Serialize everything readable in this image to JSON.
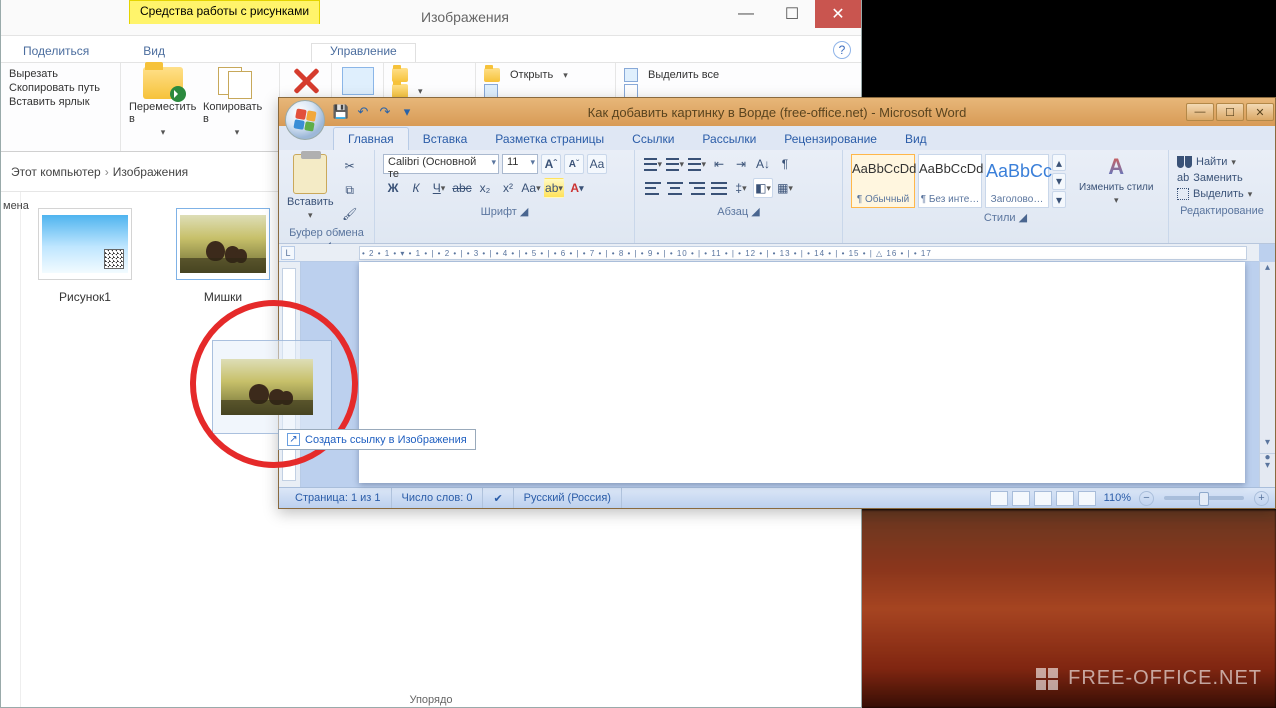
{
  "explorer": {
    "context_tab": "Средства работы с рисунками",
    "title": "Изображения",
    "tabs": {
      "share": "Поделиться",
      "view": "Вид",
      "manage": "Управление"
    },
    "ribbon": {
      "clipboard": {
        "cut": "Вырезать",
        "copy_path": "Скопировать путь",
        "paste_shortcut": "Вставить ярлык"
      },
      "org": {
        "move_to": "Переместить в",
        "copy_to": "Копировать в",
        "organize_label": "Упорядо"
      },
      "open": {
        "open": "Открыть",
        "select_all": "Выделить все"
      }
    },
    "breadcrumb": {
      "root": "Этот компьютер",
      "folder": "Изображения"
    },
    "sidebar_header": "мена",
    "files": {
      "f1": "Рисунок1",
      "f2": "Мишки"
    }
  },
  "word": {
    "title": "Как добавить картинку в Ворде (free-office.net) - Microsoft Word",
    "tabs": {
      "home": "Главная",
      "insert": "Вставка",
      "layout": "Разметка страницы",
      "refs": "Ссылки",
      "mail": "Рассылки",
      "review": "Рецензирование",
      "view": "Вид"
    },
    "ribbon": {
      "clipboard": {
        "paste": "Вставить",
        "label": "Буфер обмена"
      },
      "font": {
        "name": "Calibri (Основной те",
        "size": "11",
        "label": "Шрифт"
      },
      "para": {
        "label": "Абзац"
      },
      "styles": {
        "label": "Стили",
        "sample": "AaBbCcDd",
        "sample_head": "AaBbCc",
        "normal": "¶ Обычный",
        "nospace": "¶ Без инте…",
        "heading": "Заголово…",
        "change": "Изменить стили"
      },
      "edit": {
        "find": "Найти",
        "replace": "Заменить",
        "select": "Выделить",
        "label": "Редактирование"
      }
    },
    "status": {
      "page": "Страница: 1 из 1",
      "words": "Число слов: 0",
      "lang": "Русский (Россия)",
      "zoom": "110%"
    }
  },
  "drag": {
    "tooltip": "Создать ссылку в Изображения"
  },
  "watermark": "FREE-OFFICE.NET",
  "ruler_ticks": "• 2 • 1 • ▾ • 1 • | • 2 • | • 3 • | • 4 • | • 5 • | • 6 • | • 7 • | • 8 • | • 9 • | • 10 • | • 11 • | • 12 • | • 13 • | • 14 • | • 15 • | △ 16 • | • 17"
}
